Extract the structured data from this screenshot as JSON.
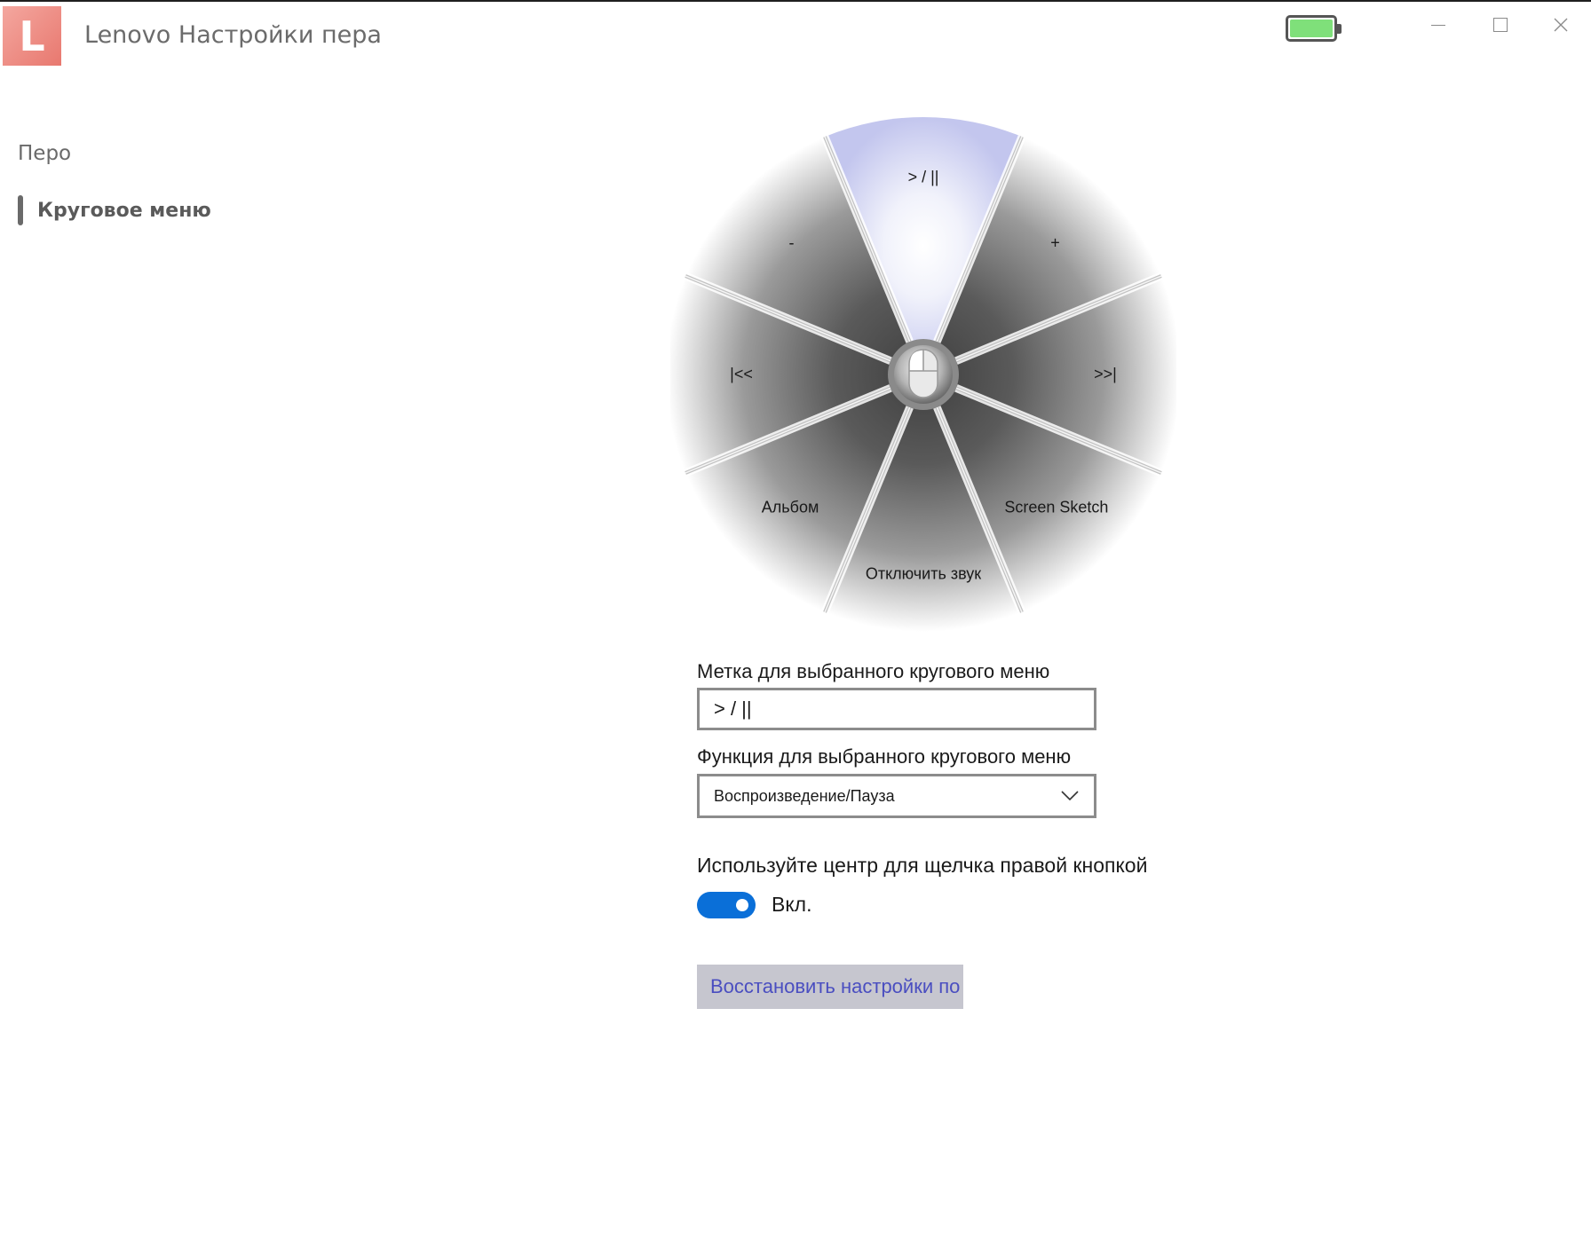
{
  "window": {
    "logo_letter": "L",
    "title": "Lenovo Настройки пера",
    "battery_level": 1.0,
    "battery_color": "#7fe07a"
  },
  "sidebar": {
    "items": [
      {
        "label": "Перо",
        "selected": false
      },
      {
        "label": "Круговое меню",
        "selected": true
      }
    ]
  },
  "radial_menu": {
    "selected_index": 0,
    "selected_color": "#cfd2f2",
    "sectors": [
      {
        "label": "> / ||"
      },
      {
        "label": "+"
      },
      {
        "label": ">>|"
      },
      {
        "label": "Screen Sketch"
      },
      {
        "label": "Отключить звук"
      },
      {
        "label": "Альбом"
      },
      {
        "label": "|<<"
      },
      {
        "label": "-"
      }
    ]
  },
  "form": {
    "label_field_title": "Метка для выбранного кругового меню",
    "label_field_value": "> / ||",
    "function_field_title": "Функция для выбранного кругового меню",
    "function_field_value": "Воспроизведение/Пауза",
    "center_click_title": "Используйте центр для щелчка правой кнопкой мыши",
    "center_click_toggle_on": true,
    "center_click_toggle_text": "Вкл.",
    "accent_color": "#0a6fd8",
    "reset_button_label": "Восстановить настройки по умолчанию"
  }
}
